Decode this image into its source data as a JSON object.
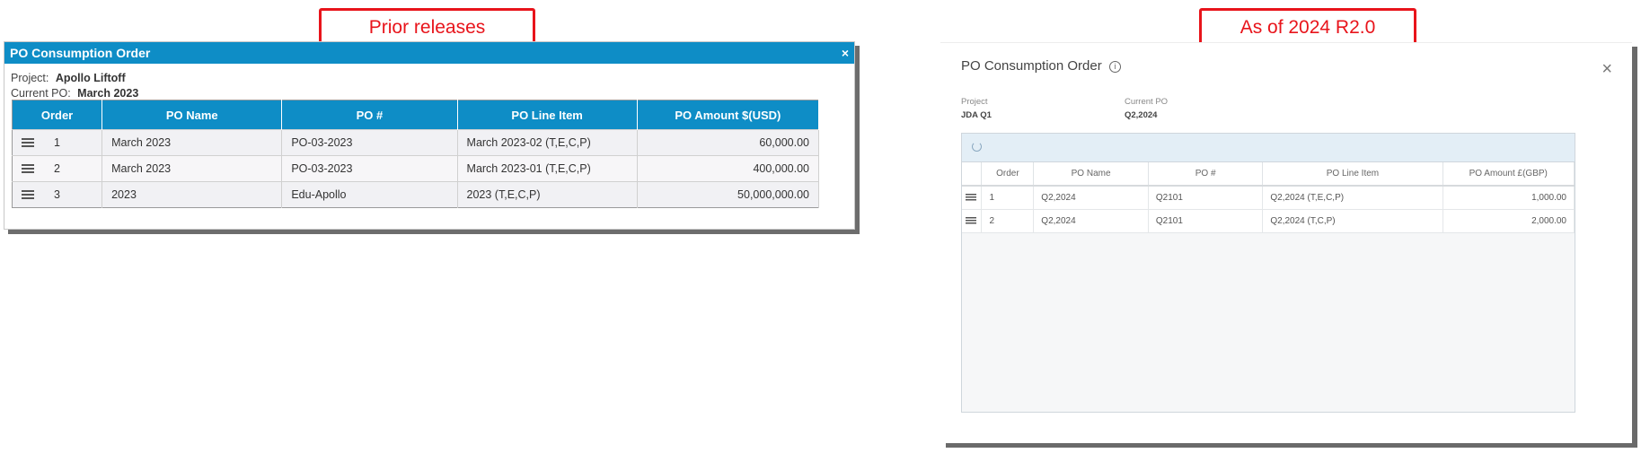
{
  "callouts": {
    "prior": "Prior releases",
    "new": "As of 2024 R2.0"
  },
  "old_dialog": {
    "title": "PO Consumption Order",
    "close_glyph": "×",
    "project_label": "Project:",
    "project_value": "Apollo Liftoff",
    "current_po_label": "Current PO:",
    "current_po_value": "March 2023",
    "columns": [
      "Order",
      "PO Name",
      "PO #",
      "PO Line Item",
      "PO Amount $(USD)"
    ],
    "rows": [
      {
        "order": "1",
        "po_name": "March 2023",
        "po_num": "PO-03-2023",
        "line_item": "March 2023-02 (T,E,C,P)",
        "amount": "60,000.00"
      },
      {
        "order": "2",
        "po_name": "March 2023",
        "po_num": "PO-03-2023",
        "line_item": "March 2023-01 (T,E,C,P)",
        "amount": "400,000.00"
      },
      {
        "order": "3",
        "po_name": "2023",
        "po_num": "Edu-Apollo",
        "line_item": "2023 (T,E,C,P)",
        "amount": "50,000,000.00"
      }
    ]
  },
  "new_dialog": {
    "title": "PO Consumption Order",
    "info_glyph": "i",
    "close_glyph": "×",
    "project_label": "Project",
    "project_value": "JDA Q1",
    "current_po_label": "Current PO",
    "current_po_value": "Q2,2024",
    "columns": [
      "Order",
      "PO Name",
      "PO #",
      "PO Line Item",
      "PO Amount £(GBP)"
    ],
    "rows": [
      {
        "order": "1",
        "po_name": "Q2,2024",
        "po_num": "Q2101",
        "line_item": "Q2,2024 (T,E,C,P)",
        "amount": "1,000.00"
      },
      {
        "order": "2",
        "po_name": "Q2,2024",
        "po_num": "Q2101",
        "line_item": "Q2,2024 (T,C,P)",
        "amount": "2,000.00"
      }
    ]
  },
  "icons": {
    "drag_handle": "drag-handle-icon",
    "refresh": "refresh-icon",
    "info": "info-icon",
    "close": "close-icon"
  },
  "colors": {
    "callout_red": "#e8141b",
    "old_header_blue": "#0e8dc6",
    "new_toolbar": "#e3eef6"
  }
}
